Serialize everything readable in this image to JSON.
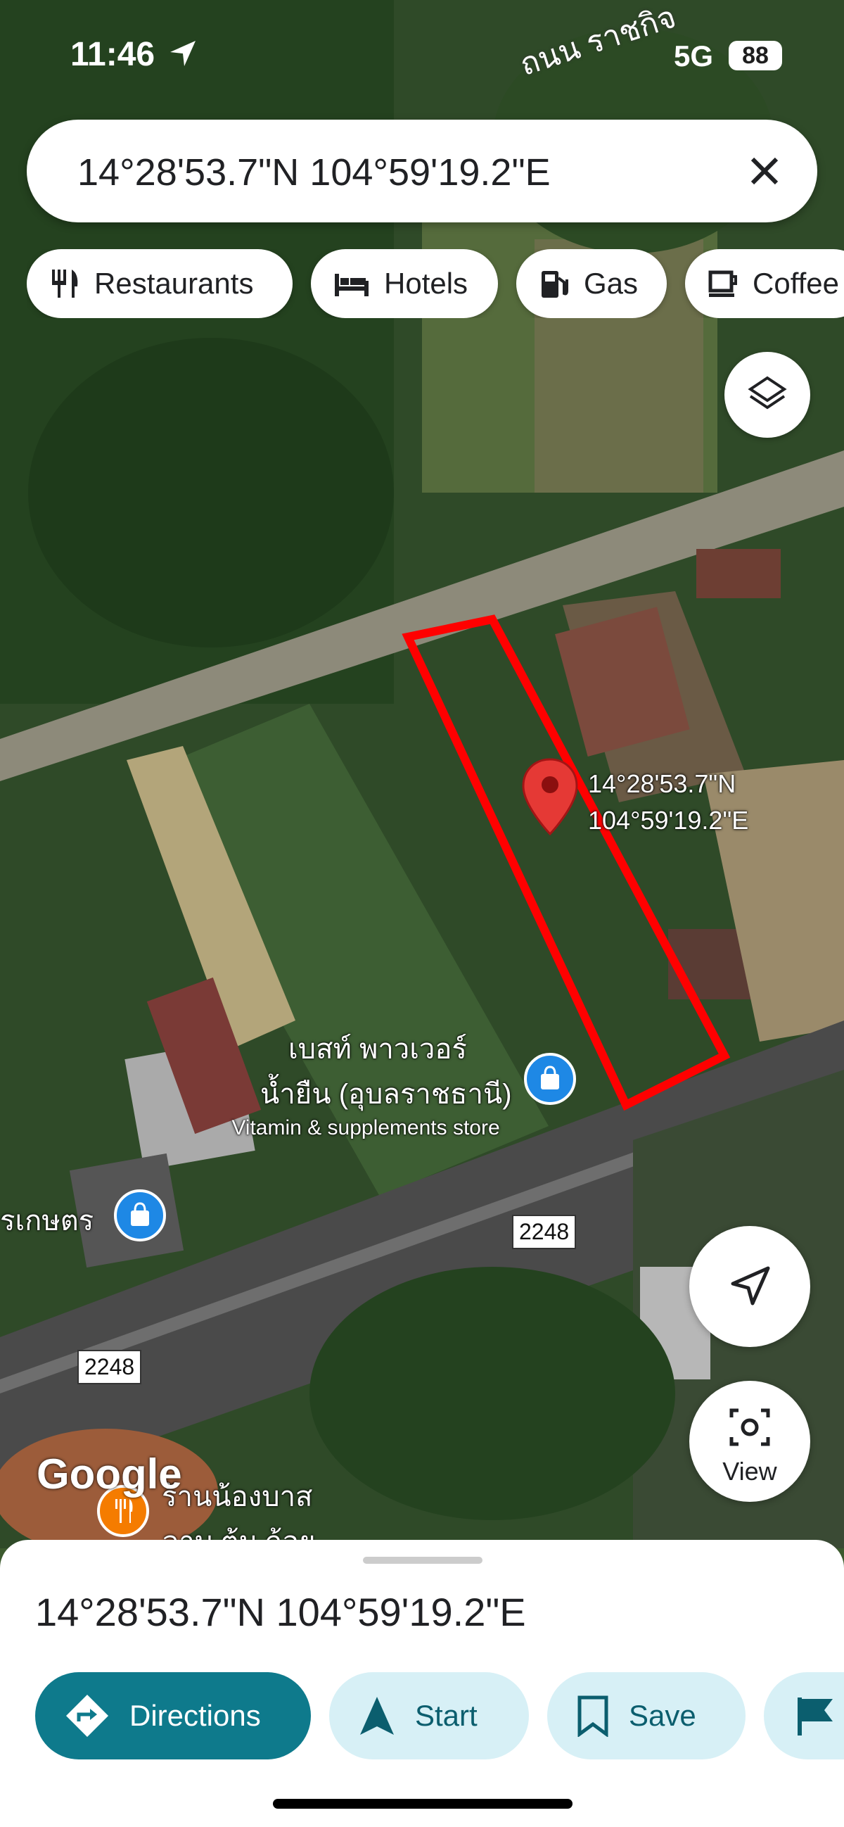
{
  "status_bar": {
    "time": "11:46",
    "network": "5G",
    "battery": "88",
    "road_label": "ถนน ราชกิจ"
  },
  "search": {
    "query": "14°28'53.7\"N 104°59'19.2\"E"
  },
  "chips": [
    {
      "label": "Restaurants",
      "icon": "fork-knife-icon"
    },
    {
      "label": "Hotels",
      "icon": "bed-icon"
    },
    {
      "label": "Gas",
      "icon": "gas-pump-icon"
    },
    {
      "label": "Coffee",
      "icon": "coffee-cup-icon"
    }
  ],
  "pin": {
    "lat": "14°28'53.7\"N",
    "lng": "104°59'19.2\"E"
  },
  "pois": [
    {
      "name_line1": "เบสท์ พาวเวอร์",
      "name_line2": "น้ำยืน (อุบลราชธานี)",
      "category": "Vitamin & supplements store"
    },
    {
      "name": "รเกษตร"
    },
    {
      "name_line1": "ร้านน้องบาส",
      "name_line2": "ลาบ ต้ม ก้อย"
    }
  ],
  "road_shields": [
    "2248",
    "2248"
  ],
  "map_buttons": {
    "view_label": "View"
  },
  "logo": "Google",
  "sheet": {
    "title": "14°28'53.7\"N 104°59'19.2\"E",
    "actions": [
      {
        "label": "Directions"
      },
      {
        "label": "Start"
      },
      {
        "label": "Save"
      },
      {
        "label": ""
      }
    ]
  },
  "colors": {
    "accent": "#0e7a8c",
    "pin": "#e53935",
    "outline": "#ff0000"
  }
}
